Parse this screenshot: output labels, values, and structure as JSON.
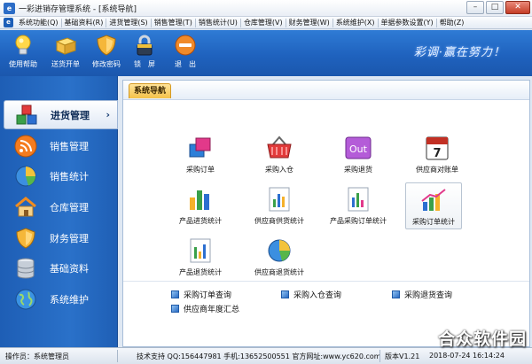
{
  "window": {
    "title": "一彩进销存管理系统 - [系统导航]",
    "controls": [
      "–",
      "□",
      "✕"
    ]
  },
  "menubar": {
    "items": [
      "系统功能(Q)",
      "基础资料(R)",
      "进货管理(S)",
      "销售管理(T)",
      "销售统计(U)",
      "仓库管理(V)",
      "财务管理(W)",
      "系统维护(X)",
      "单据参数设置(Y)",
      "帮助(Z)"
    ]
  },
  "toolbar": {
    "items": [
      {
        "label": "使用帮助",
        "icon": "lightbulb-icon"
      },
      {
        "label": "送货开单",
        "icon": "delivery-icon"
      },
      {
        "label": "修改密码",
        "icon": "shield-icon"
      },
      {
        "label": "锁　屏",
        "icon": "lock-icon"
      },
      {
        "label": "退　出",
        "icon": "exit-icon"
      }
    ],
    "slogan": "彩调·赢在努力！"
  },
  "sidebar": {
    "items": [
      {
        "label": "进货管理",
        "icon": "cubes-icon",
        "active": true
      },
      {
        "label": "销售管理",
        "icon": "rss-icon"
      },
      {
        "label": "销售统计",
        "icon": "pie-chart-icon"
      },
      {
        "label": "仓库管理",
        "icon": "house-icon"
      },
      {
        "label": "财务管理",
        "icon": "shield-icon"
      },
      {
        "label": "基础资料",
        "icon": "database-icon"
      },
      {
        "label": "系统维护",
        "icon": "globe-icon"
      }
    ],
    "active_marker": "›"
  },
  "content": {
    "tab": "系统导航",
    "functions": [
      {
        "label": "采购订单",
        "icon": "purchase-order-icon"
      },
      {
        "label": "采购入仓",
        "icon": "basket-icon"
      },
      {
        "label": "采购退货",
        "icon": "out-icon",
        "icon_text": "Out"
      },
      {
        "label": "供应商对账单",
        "icon": "calendar-icon",
        "icon_text": "7"
      },
      {
        "label": "产品进货统计",
        "icon": "bar-chart-icon"
      },
      {
        "label": "供应商供货统计",
        "icon": "report-chart-icon"
      },
      {
        "label": "产品采购订单统计",
        "icon": "report-chart-icon"
      },
      {
        "label": "采购订单统计",
        "icon": "trend-chart-icon",
        "selected": true
      },
      {
        "label": "产品退货统计",
        "icon": "report-chart-icon"
      },
      {
        "label": "供应商退货统计",
        "icon": "pie-chart-icon"
      }
    ],
    "queries": [
      "采购订单查询",
      "采购入仓查询",
      "采购退货查询",
      "供应商年度汇总"
    ]
  },
  "statusbar": {
    "operator": "操作员：系统管理员",
    "support": "技术支持 QQ:156447981 手机:13652500551 官方网址:www.yc620.com",
    "version": "版本V1.21",
    "datetime": "2018-07-24 16:14:24"
  },
  "watermark": "合众软件园",
  "colors": {
    "toolbar": "#1f62be",
    "sidebar": "#2a71c9",
    "tab": "#f4c24a"
  }
}
